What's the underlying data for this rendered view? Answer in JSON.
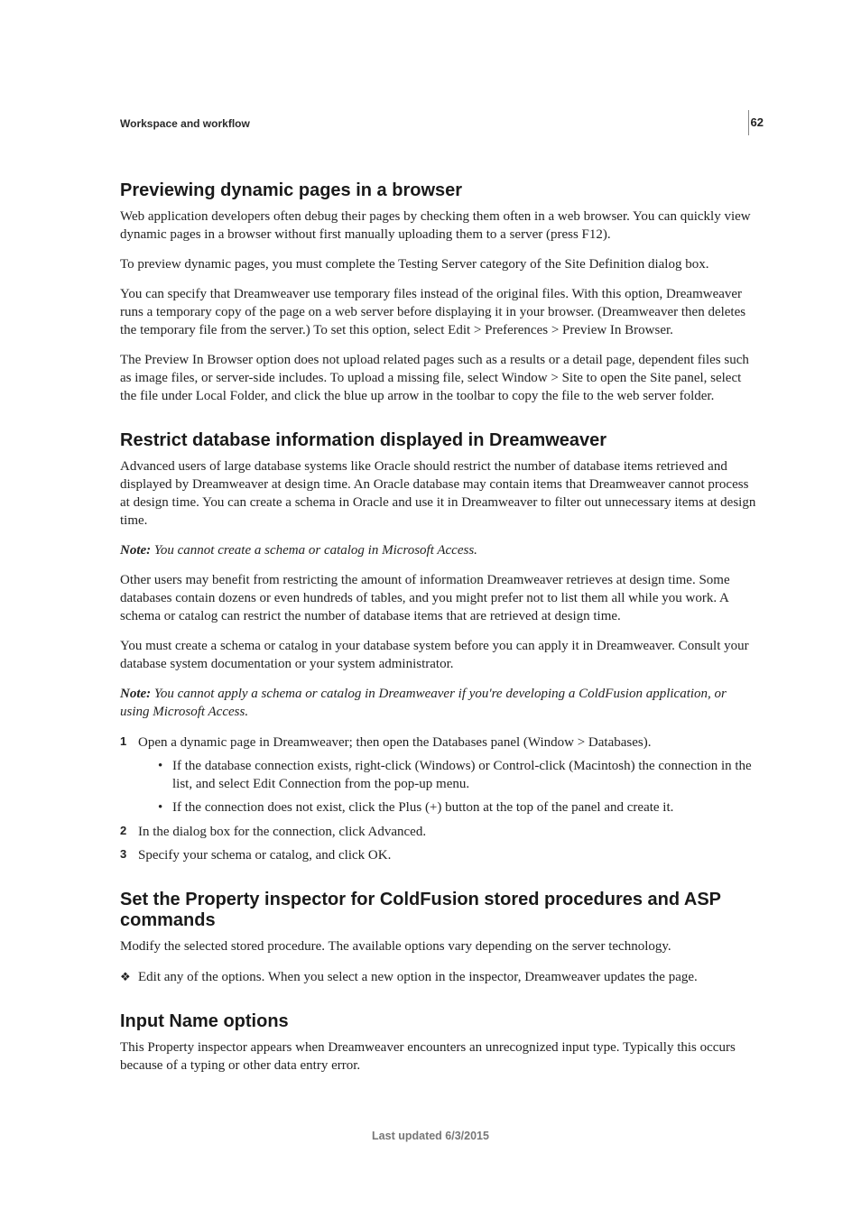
{
  "page_number": "62",
  "breadcrumb": "Workspace and workflow",
  "footer": "Last updated 6/3/2015",
  "s1": {
    "heading": "Previewing dynamic pages in a browser",
    "p1": "Web application developers often debug their pages by checking them often in a web browser. You can quickly view dynamic pages in a browser without first manually uploading them to a server (press F12).",
    "p2": "To preview dynamic pages, you must complete the Testing Server category of the Site Definition dialog box.",
    "p3": "You can specify that Dreamweaver use temporary files instead of the original files. With this option, Dreamweaver runs a temporary copy of the page on a web server before displaying it in your browser. (Dreamweaver then deletes the temporary file from the server.) To set this option, select Edit > Preferences > Preview In Browser.",
    "p4": "The Preview In Browser option does not upload related pages such as a results or a detail page, dependent files such as image files, or server-side includes. To upload a missing file, select Window > Site to open the Site panel, select the file under Local Folder, and click the blue up arrow in the toolbar to copy the file to the web server folder."
  },
  "s2": {
    "heading": "Restrict database information displayed in Dreamweaver",
    "p1": "Advanced users of large database systems like Oracle should restrict the number of database items retrieved and displayed by Dreamweaver at design time. An Oracle database may contain items that Dreamweaver cannot process at design time. You can create a schema in Oracle and use it in Dreamweaver to filter out unnecessary items at design time.",
    "note1_label": "Note:",
    "note1_body": " You cannot create a schema or catalog in Microsoft Access.",
    "p2": "Other users may benefit from restricting the amount of information Dreamweaver retrieves at design time. Some databases contain dozens or even hundreds of tables, and you might prefer not to list them all while you work. A schema or catalog can restrict the number of database items that are retrieved at design time.",
    "p3": "You must create a schema or catalog in your database system before you can apply it in Dreamweaver. Consult your database system documentation or your system administrator.",
    "note2_label": "Note:",
    "note2_body": " You cannot apply a schema or catalog in Dreamweaver if you're developing a ColdFusion application, or using Microsoft Access.",
    "step1": "Open a dynamic page in Dreamweaver; then open the Databases panel (Window > Databases).",
    "step1a": "If the database connection exists, right-click (Windows) or Control-click (Macintosh) the connection in the list, and select Edit Connection from the pop-up menu.",
    "step1b": "If the connection does not exist, click the Plus (+) button at the top of the panel and create it.",
    "step2": "In the dialog box for the connection, click Advanced.",
    "step3": "Specify your schema or catalog, and click OK."
  },
  "s3": {
    "heading": "Set the Property inspector for ColdFusion stored procedures and ASP commands",
    "p1": "Modify the selected stored procedure. The available options vary depending on the server technology.",
    "d1": "Edit any of the options. When you select a new option in the inspector, Dreamweaver updates the page."
  },
  "s4": {
    "heading": "Input Name options",
    "p1": "This Property inspector appears when Dreamweaver encounters an unrecognized input type. Typically this occurs because of a typing or other data entry error."
  }
}
